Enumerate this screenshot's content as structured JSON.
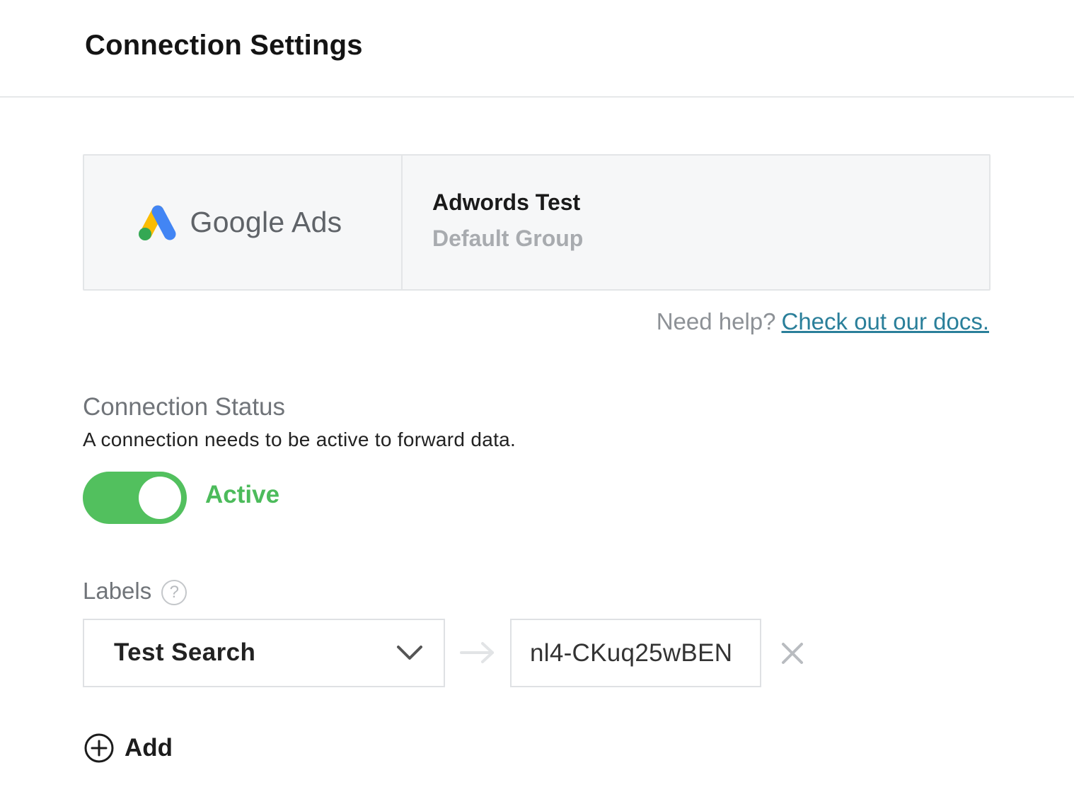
{
  "header": {
    "title": "Connection Settings"
  },
  "integration": {
    "logo_text": "Google Ads",
    "connection_name": "Adwords Test",
    "group": "Default Group",
    "logo_colors": {
      "yellow": "#fbbc04",
      "blue": "#4285f4",
      "green": "#34a853"
    }
  },
  "help": {
    "prefix": "Need help?",
    "link": "Check out our docs."
  },
  "status": {
    "title": "Connection Status",
    "description": "A connection needs to be active to forward data.",
    "toggle_on": true,
    "toggle_label": "Active",
    "accent_color": "#52c05e"
  },
  "labels": {
    "title": "Labels",
    "help_glyph": "?",
    "rows": [
      {
        "selected": "Test Search",
        "value": "nl4-CKuq25wBEN"
      }
    ]
  },
  "add": {
    "label": "Add"
  }
}
